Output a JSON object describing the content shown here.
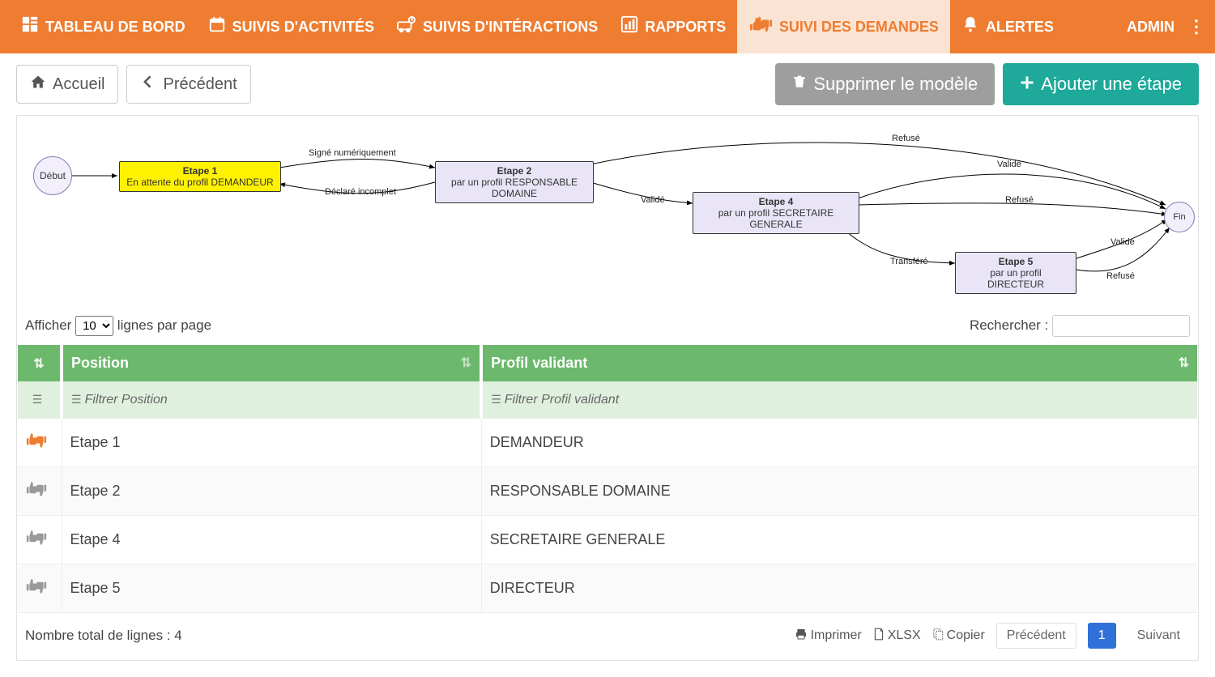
{
  "nav": {
    "items": [
      {
        "label": "TABLEAU DE BORD",
        "icon": "dashboard"
      },
      {
        "label": "SUIVIS D'ACTIVITÉS",
        "icon": "calendar"
      },
      {
        "label": "SUIVIS D'INTÉRACTIONS",
        "icon": "suivi"
      },
      {
        "label": "RAPPORTS",
        "icon": "chart"
      },
      {
        "label": "SUIVI DES DEMANDES",
        "icon": "thumbs",
        "active": true
      },
      {
        "label": "ALERTES",
        "icon": "bell"
      }
    ],
    "admin": "ADMIN"
  },
  "actions": {
    "home": "Accueil",
    "back": "Précédent",
    "delete": "Supprimer le modèle",
    "add": "Ajouter une étape"
  },
  "diagram": {
    "start": "Début",
    "end": "Fin",
    "nodes": [
      {
        "id": "e1",
        "title": "Etape 1",
        "sub": "En attente du profil DEMANDEUR"
      },
      {
        "id": "e2",
        "title": "Etape 2",
        "sub": "par un profil RESPONSABLE DOMAINE"
      },
      {
        "id": "e4",
        "title": "Etape 4",
        "sub": "par un profil SECRETAIRE GENERALE"
      },
      {
        "id": "e5",
        "title": "Etape 5",
        "sub": "par un profil DIRECTEUR"
      }
    ],
    "edges": [
      {
        "label": "Signé numériquement"
      },
      {
        "label": "Déclaré incomplet"
      },
      {
        "label": "Validé"
      },
      {
        "label": "Refusé"
      },
      {
        "label": "Validé"
      },
      {
        "label": "Refusé"
      },
      {
        "label": "Transféré"
      },
      {
        "label": "Validé"
      },
      {
        "label": "Refusé"
      }
    ]
  },
  "table": {
    "show_label_pre": "Afficher",
    "show_label_post": "lignes par page",
    "page_size": "10",
    "search_label": "Rechercher :",
    "columns": {
      "position": "Position",
      "profil": "Profil validant"
    },
    "filters": {
      "position": "Filtrer Position",
      "profil": "Filtrer Profil validant"
    },
    "rows": [
      {
        "position": "Etape 1",
        "profil": "DEMANDEUR",
        "active": true
      },
      {
        "position": "Etape 2",
        "profil": "RESPONSABLE DOMAINE",
        "active": false
      },
      {
        "position": "Etape 4",
        "profil": "SECRETAIRE GENERALE",
        "active": false
      },
      {
        "position": "Etape 5",
        "profil": "DIRECTEUR",
        "active": false
      }
    ],
    "total_label": "Nombre total de lignes : 4",
    "export": {
      "print": "Imprimer",
      "xlsx": "XLSX",
      "copy": "Copier"
    },
    "pagination": {
      "prev": "Précédent",
      "page": "1",
      "next": "Suivant"
    }
  }
}
